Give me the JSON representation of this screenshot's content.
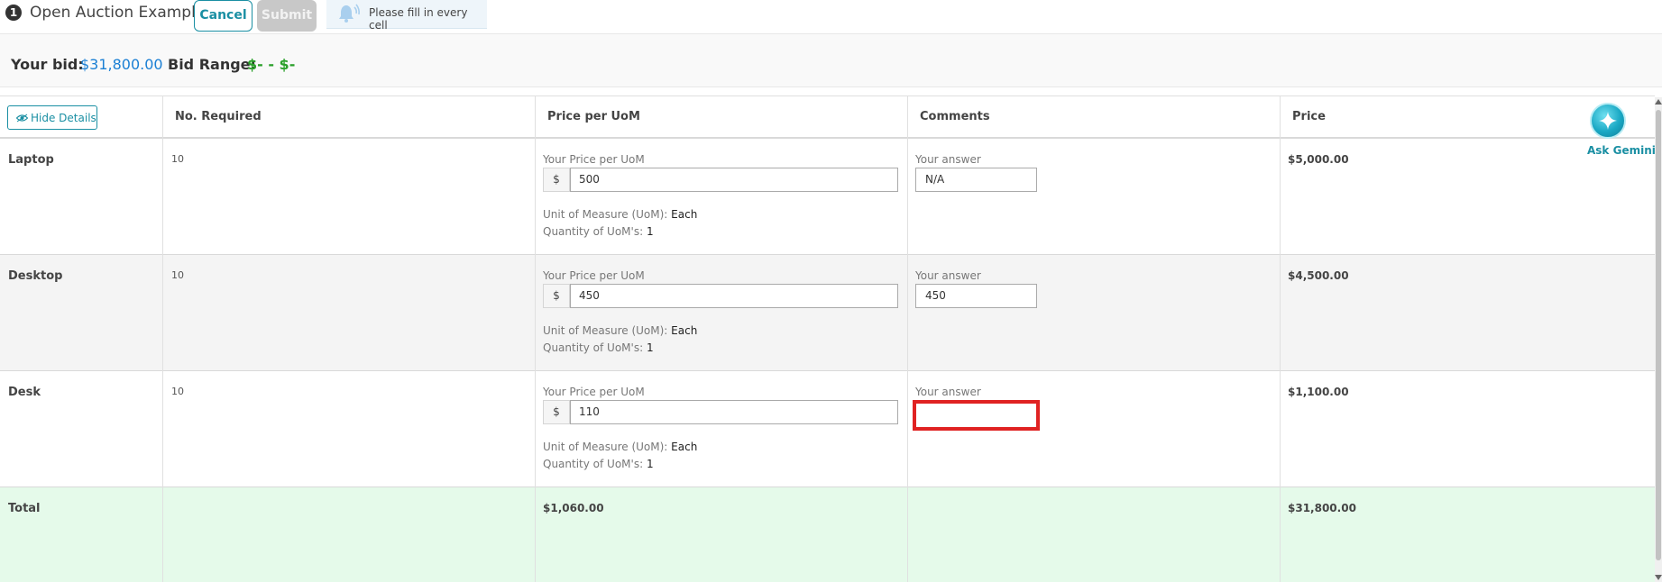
{
  "header": {
    "step_number": "1",
    "title": "Open Auction Example",
    "cancel_label": "Cancel",
    "submit_label": "Submit",
    "notice_text": "Please fill in every cell",
    "notice_icon": "bell-icon"
  },
  "summary": {
    "your_bid_label": "Your bid:",
    "your_bid_value": "$31,800.00",
    "bid_range_label": "Bid Range:",
    "bid_range_value": "$- - $-"
  },
  "table": {
    "hide_details_label": "Hide Details",
    "columns": [
      "No. Required",
      "Price per UoM",
      "Comments",
      "Price"
    ],
    "price_field_label": "Your Price per UoM",
    "currency_symbol": "$",
    "uom_label": "Unit of Measure (UoM):",
    "qty_uom_label": "Quantity of UoM's:",
    "comment_field_label": "Your answer",
    "rows": [
      {
        "name": "Laptop",
        "required": "10",
        "price_per_uom": "500",
        "uom": "Each",
        "qty_uom": "1",
        "comment": "N/A",
        "price": "$5,000.00"
      },
      {
        "name": "Desktop",
        "required": "10",
        "price_per_uom": "450",
        "uom": "Each",
        "qty_uom": "1",
        "comment": "450",
        "price": "$4,500.00"
      },
      {
        "name": "Desk",
        "required": "10",
        "price_per_uom": "110",
        "uom": "Each",
        "qty_uom": "1",
        "comment": "",
        "price": "$1,100.00"
      }
    ],
    "total": {
      "label": "Total",
      "price_per_uom": "$1,060.00",
      "price": "$31,800.00"
    }
  },
  "assistant": {
    "label": "Ask Gemini (B",
    "icon": "sparkle-icon"
  },
  "colors": {
    "accent": "#1a8fa3",
    "bid_value": "#1a7fd4",
    "bid_range": "#2aa02a",
    "total_row": "#e5faea",
    "flagged_field": "#e02222"
  }
}
